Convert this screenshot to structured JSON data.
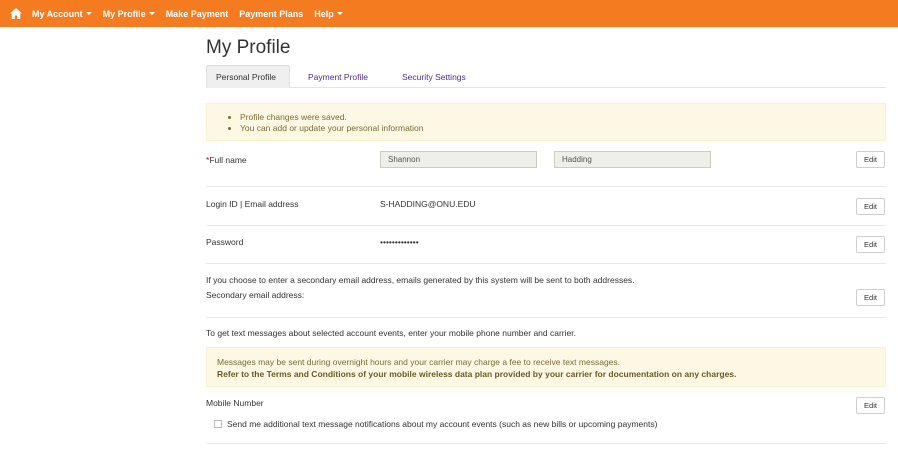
{
  "nav": {
    "items": [
      {
        "label": "My Account",
        "dropdown": true
      },
      {
        "label": "My Profile",
        "dropdown": true
      },
      {
        "label": "Make Payment",
        "dropdown": false
      },
      {
        "label": "Payment Plans",
        "dropdown": false
      },
      {
        "label": "Help",
        "dropdown": true
      }
    ]
  },
  "page": {
    "title": "My Profile"
  },
  "tabs": [
    {
      "label": "Personal Profile",
      "active": true
    },
    {
      "label": "Payment Profile",
      "active": false
    },
    {
      "label": "Security Settings",
      "active": false
    }
  ],
  "alert_saved": {
    "items": [
      "Profile changes were saved.",
      "You can add or update your personal information"
    ]
  },
  "full_name": {
    "required_mark": "*",
    "label": "Full name",
    "first": "Shannon",
    "last": "Hadding",
    "edit_label": "Edit"
  },
  "login": {
    "label": "Login ID | Email address",
    "value": "S-HADDING@ONU.EDU",
    "edit_label": "Edit"
  },
  "password": {
    "label": "Password",
    "value": "•••••••••••••",
    "edit_label": "Edit"
  },
  "secondary_email": {
    "info": "If you choose to enter a secondary email address, emails generated by this system will be sent to both addresses.",
    "label": "Secondary email address:",
    "edit_label": "Edit"
  },
  "text_messages": {
    "info": "To get text messages about selected account events, enter your mobile phone number and carrier.",
    "warning_line1": "Messages may be sent during overnight hours and your carrier may charge a fee to receive text messages.",
    "warning_line2": "Refer to the Terms and Conditions of your mobile wireless data plan provided by your carrier for documentation on any charges."
  },
  "mobile": {
    "label": "Mobile Number",
    "edit_label": "Edit",
    "checkbox_label": "Send me additional text message notifications about my account events (such as new bills or upcoming payments)",
    "checked": false
  },
  "colors": {
    "navbar": "#f47b20",
    "alert_bg": "#fcf8e3",
    "tab_link": "#4b2c8a"
  }
}
